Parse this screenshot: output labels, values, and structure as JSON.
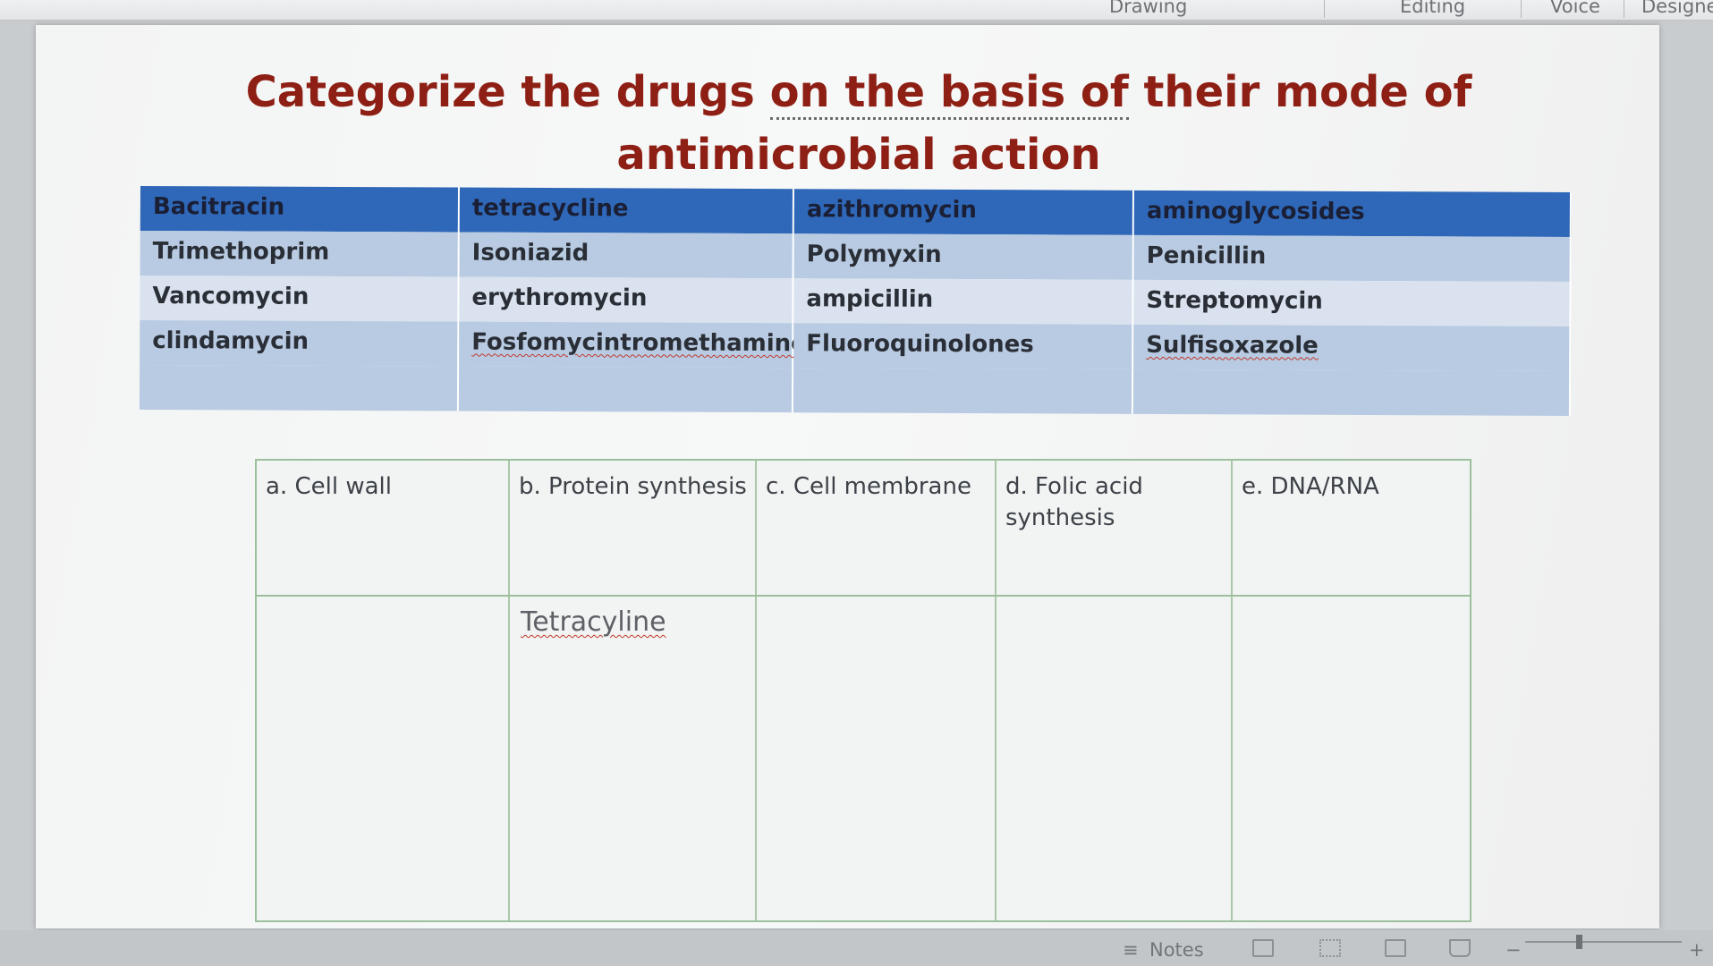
{
  "ribbon": {
    "drawing_label": "Drawing",
    "editing_label": "Editing",
    "voice_label": "Voice",
    "designer_label": "Designe"
  },
  "slide": {
    "title_part1": "Categorize the drugs ",
    "title_underlined": "on the basis of",
    "title_part2": " their mode of antimicrobial action"
  },
  "drugs_table": {
    "header": [
      "Bacitracin",
      "tetracycline",
      "azithromycin",
      "aminoglycosides"
    ],
    "rows": [
      [
        "Trimethoprim",
        "Isoniazid",
        "Polymyxin",
        "Penicillin"
      ],
      [
        "Vancomycin",
        "erythromycin",
        "ampicillin",
        "Streptomycin"
      ],
      [
        "clindamycin",
        "Fosfomycintromethamine",
        "Fluoroquinolones",
        "Sulfisoxazole"
      ]
    ]
  },
  "categories_table": {
    "headers": [
      "a. Cell wall",
      "b. Protein synthesis",
      "c. Cell membrane",
      "d. Folic acid synthesis",
      "e. DNA/RNA"
    ],
    "entries": {
      "protein_synthesis": "Tetracyline"
    }
  },
  "status_bar": {
    "notes_label": "Notes"
  }
}
